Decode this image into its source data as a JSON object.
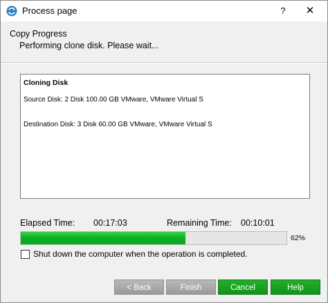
{
  "window": {
    "title": "Process page",
    "help_glyph": "?",
    "close_glyph": "✕",
    "icon": "disk-clone-icon"
  },
  "header": {
    "heading": "Copy Progress",
    "subheading": "Performing clone disk. Please wait..."
  },
  "info": {
    "title": "Cloning Disk",
    "source": "Source Disk: 2 Disk 100.00 GB VMware,  VMware Virtual S",
    "destination": "Destination Disk: 3 Disk 60.00 GB VMware,  VMware Virtual S"
  },
  "timing": {
    "elapsed_label": "Elapsed Time:",
    "elapsed_value": "00:17:03",
    "remaining_label": "Remaining Time:",
    "remaining_value": "00:10:01"
  },
  "progress": {
    "percent": 62,
    "label": "62%",
    "fill_color": "#06b025"
  },
  "shutdown": {
    "label": "Shut down the computer when the operation is completed.",
    "checked": false
  },
  "buttons": {
    "back": "< Back",
    "finish": "Finish",
    "cancel": "Cancel",
    "help": "Help"
  },
  "colors": {
    "accent_green": "#1aa322",
    "disabled_gray": "#a8a8a8"
  }
}
